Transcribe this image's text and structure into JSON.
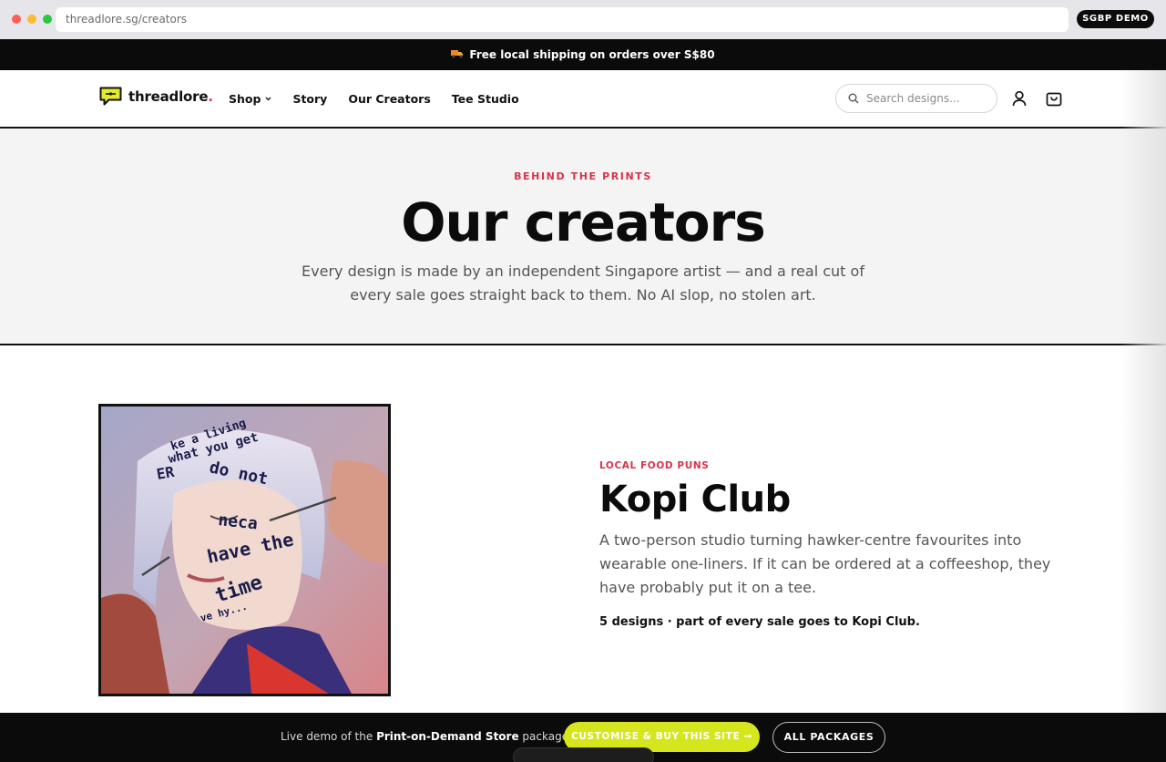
{
  "browser": {
    "url": "threadlore.sg/creators",
    "badge": "SGBP DEMO"
  },
  "promo": {
    "icon": "truck-icon",
    "text": "Free local shipping on orders over S$80"
  },
  "header": {
    "logo_text": "threadlore",
    "logo_dot": ".",
    "nav": [
      {
        "label": "Shop",
        "has_dropdown": true
      },
      {
        "label": "Story"
      },
      {
        "label": "Our Creators"
      },
      {
        "label": "Tee Studio"
      }
    ],
    "search_placeholder": "Search designs...",
    "icons": [
      "search-icon",
      "account-icon",
      "cart-icon"
    ]
  },
  "hero": {
    "eyebrow": "BEHIND THE PRINTS",
    "title": "Our creators",
    "subtitle": "Every design is made by an independent Singapore artist — and a real cut of every sale goes straight back to them. No AI slop, no stolen art."
  },
  "creator": {
    "category": "LOCAL FOOD PUNS",
    "name": "Kopi Club",
    "description": "A two-person studio turning hawker-centre favourites into wearable one-liners. If it can be ordered at a coffeeshop, they have probably put it on a tee.",
    "stats": "5 designs · part of every sale goes to Kopi Club.",
    "photo_words": [
      "ke a living",
      "what you get",
      "ER",
      "do not",
      "neca",
      "have the",
      "time",
      "ve hy..."
    ]
  },
  "bottom_bar": {
    "text_prefix": "Live demo of the ",
    "text_bold": "Print-on-Demand Store",
    "text_suffix": " package.",
    "cta_label": "CUSTOMISE & BUY THIS SITE →",
    "secondary_label": "ALL PACKAGES"
  },
  "colors": {
    "accent": "#d9334a",
    "cta": "#d6e61e",
    "dark": "#0b0b0b",
    "hero_bg": "#f4f4f4"
  }
}
